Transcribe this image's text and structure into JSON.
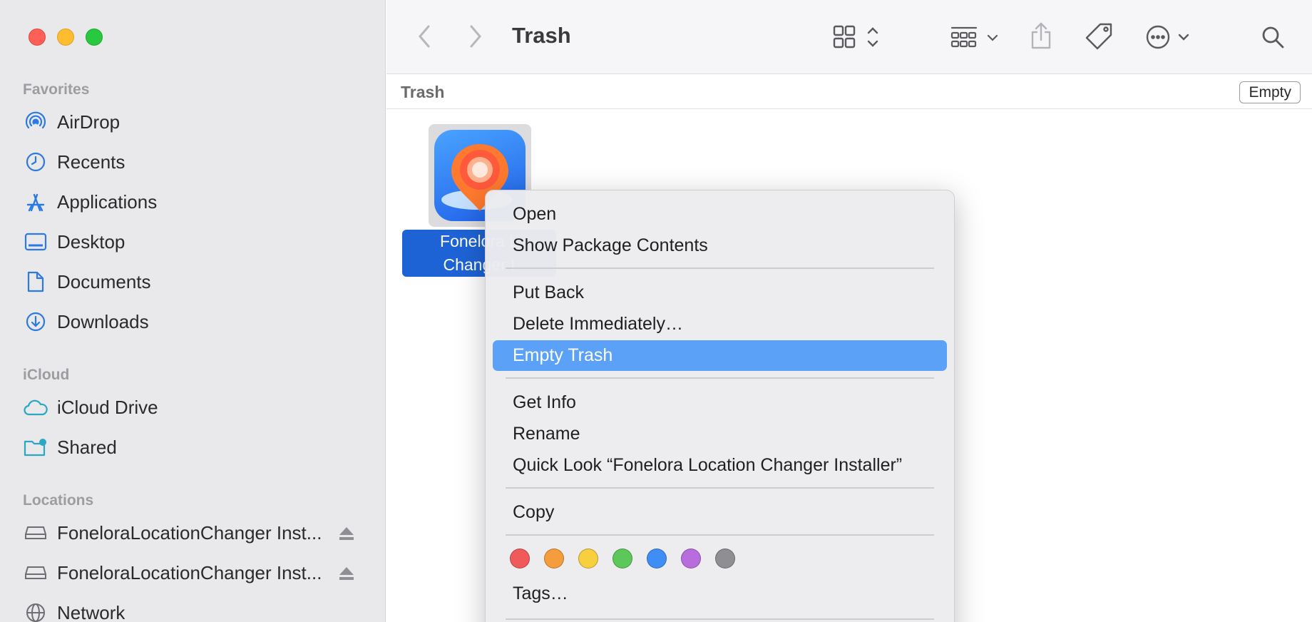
{
  "window": {
    "title": "Trash"
  },
  "sidebar": {
    "sections": {
      "favorites": "Favorites",
      "icloud": "iCloud",
      "locations": "Locations"
    },
    "favorites": [
      {
        "label": "AirDrop",
        "icon": "airdrop-icon"
      },
      {
        "label": "Recents",
        "icon": "clock-icon"
      },
      {
        "label": "Applications",
        "icon": "applications-icon"
      },
      {
        "label": "Desktop",
        "icon": "desktop-icon"
      },
      {
        "label": "Documents",
        "icon": "document-icon"
      },
      {
        "label": "Downloads",
        "icon": "download-icon"
      }
    ],
    "icloud": [
      {
        "label": "iCloud Drive",
        "icon": "cloud-icon"
      },
      {
        "label": "Shared",
        "icon": "shared-folder-icon"
      }
    ],
    "locations": [
      {
        "label": "FoneloraLocationChanger Inst...",
        "icon": "disk-icon"
      },
      {
        "label": "FoneloraLocationChanger Inst...",
        "icon": "disk-icon"
      },
      {
        "label": "Network",
        "icon": "network-icon"
      }
    ]
  },
  "pathbar": {
    "title": "Trash",
    "empty_label": "Empty"
  },
  "file": {
    "name_line1": "Fonelora L",
    "name_line2": "Changer I"
  },
  "context_menu": {
    "open": "Open",
    "show_package": "Show Package Contents",
    "put_back": "Put Back",
    "delete_immediately": "Delete Immediately…",
    "empty_trash": "Empty Trash",
    "get_info": "Get Info",
    "rename": "Rename",
    "quick_look": "Quick Look “Fonelora Location Changer Installer”",
    "copy": "Copy",
    "tags": "Tags…"
  },
  "tag_colors": [
    "#f05a5a",
    "#f59c3c",
    "#f7cf3f",
    "#5cc85a",
    "#3f8ef5",
    "#b86ddc",
    "#8e8e93"
  ],
  "colors": {
    "accent": "#2a7ae2",
    "menu_highlight": "#5aa1f7",
    "selection": "#1e63d6"
  }
}
